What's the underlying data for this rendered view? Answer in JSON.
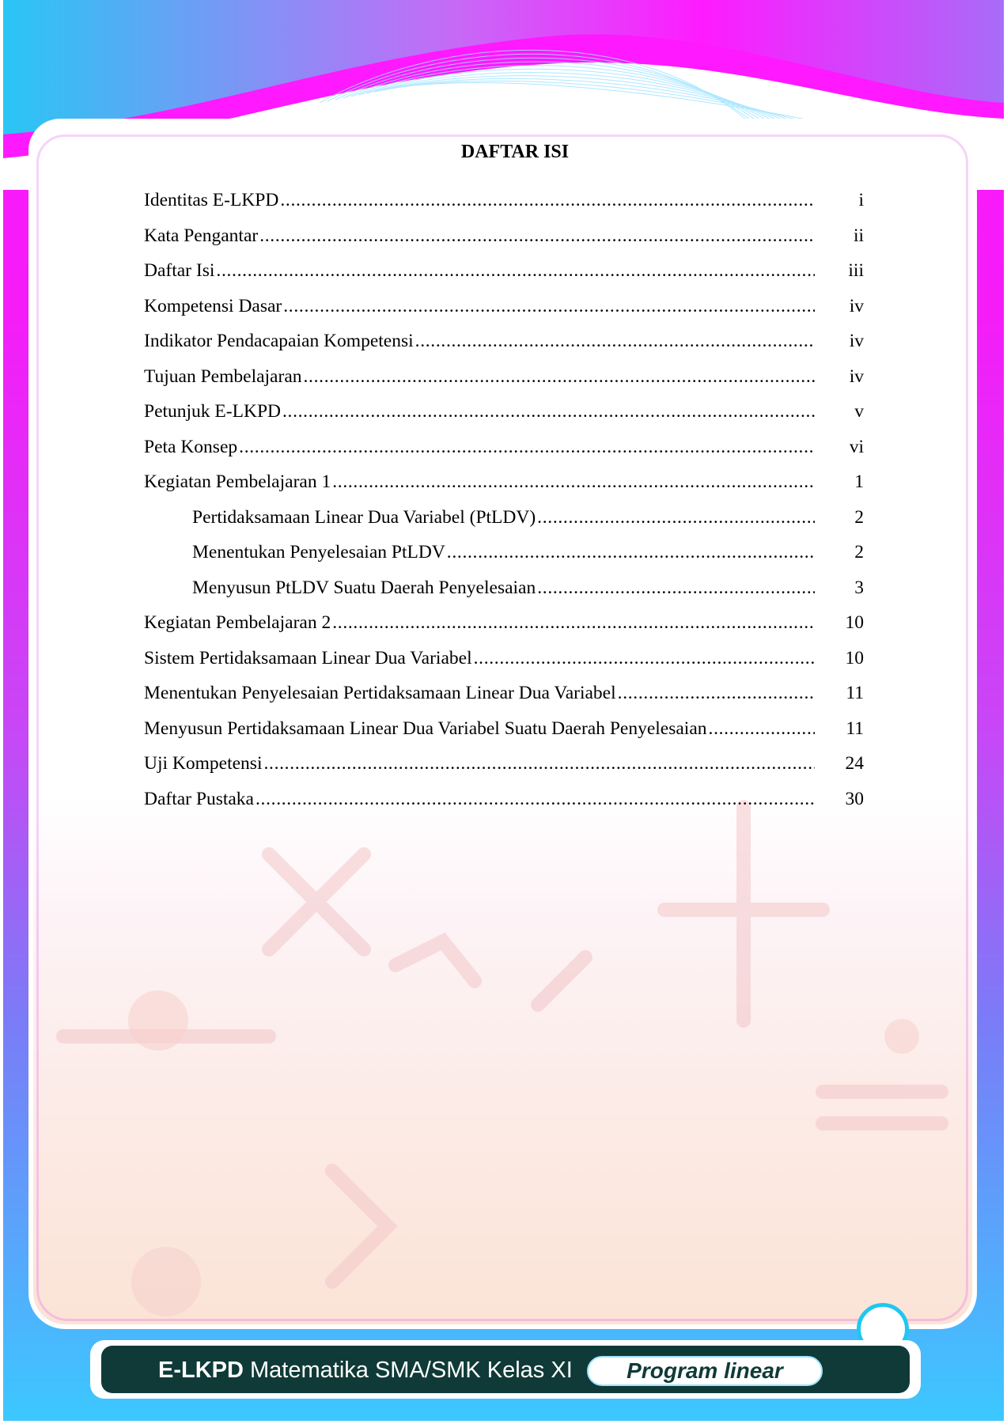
{
  "toc": {
    "heading": "DAFTAR ISI",
    "entries": [
      {
        "label": "Identitas E-LKPD",
        "page": "i",
        "indent": false
      },
      {
        "label": "Kata Pengantar",
        "page": "ii",
        "indent": false
      },
      {
        "label": "Daftar Isi",
        "page": "iii",
        "indent": false
      },
      {
        "label": "Kompetensi Dasar",
        "page": "iv",
        "indent": false
      },
      {
        "label": "Indikator Pendacapaian Kompetensi",
        "page": "iv",
        "indent": false
      },
      {
        "label": "Tujuan Pembelajaran",
        "page": "iv",
        "indent": false
      },
      {
        "label": "Petunjuk E-LKPD",
        "page": "v",
        "indent": false
      },
      {
        "label": "Peta Konsep",
        "page": "vi",
        "indent": false
      },
      {
        "label": "Kegiatan Pembelajaran 1",
        "page": "1",
        "indent": false
      },
      {
        "label": "Pertidaksamaan Linear Dua Variabel (PtLDV)",
        "page": "2",
        "indent": true
      },
      {
        "label": "Menentukan Penyelesaian PtLDV",
        "page": "2",
        "indent": true
      },
      {
        "label": "Menyusun PtLDV Suatu Daerah Penyelesaian",
        "page": "3",
        "indent": true
      },
      {
        "label": "Kegiatan Pembelajaran 2",
        "page": "10",
        "indent": false
      },
      {
        "label": "Sistem Pertidaksamaan Linear Dua Variabel",
        "page": "10",
        "indent": false
      },
      {
        "label": "Menentukan Penyelesaian Pertidaksamaan Linear Dua Variabel",
        "page": "11",
        "indent": false
      },
      {
        "label": "Menyusun Pertidaksamaan Linear Dua Variabel Suatu Daerah Penyelesaian",
        "page": "11",
        "indent": false
      },
      {
        "label": "Uji Kompetensi",
        "page": "24",
        "indent": false
      },
      {
        "label": "Daftar Pustaka",
        "page": "30",
        "indent": false
      }
    ]
  },
  "footer": {
    "brand": "E-LKPD",
    "subtitle": " Matematika SMA/SMK Kelas XI",
    "topic": "Program linear"
  },
  "colors": {
    "frame_top": "#ff19ff",
    "frame_bottom": "#3cc8ff",
    "footer_bar": "#0f3a37",
    "circle_ring": "#1fc7f2"
  },
  "icons": [
    "wave-lines-decoration",
    "math-symbols-watermark"
  ]
}
